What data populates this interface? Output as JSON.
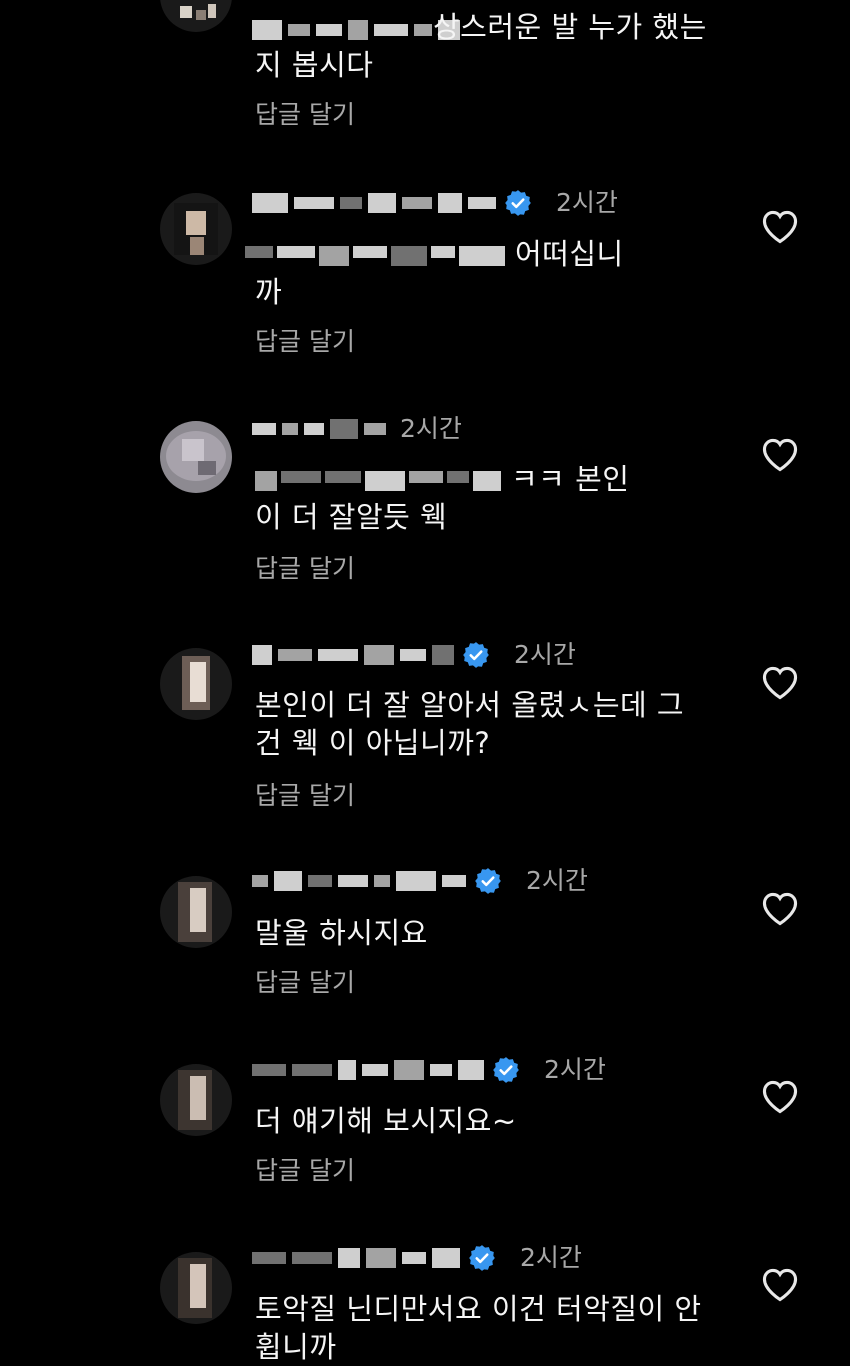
{
  "colors": {
    "background": "#000000",
    "text": "#f5f5f5",
    "muted": "#a8a8a8",
    "verified": "#3897f0"
  },
  "icons": {
    "like": "heart-outline-icon",
    "verified": "verified-badge-icon"
  },
  "comments": [
    {
      "text_line1": "상스러운 발 누가 했는",
      "text_line2": "지 봅시다",
      "reply": "답글 달기"
    },
    {
      "time": "2시간",
      "text_line1": "어떠십니",
      "text_line2": "까",
      "reply": "답글 달기"
    },
    {
      "time": "2시간",
      "text_line1": "ㅋㅋ 본인",
      "text_line2": "이 더 잘알듯 웩",
      "reply": "답글 달기"
    },
    {
      "time": "2시간",
      "text_line1": "본인이 더 잘 알아서 올렸ㅅ는데 그",
      "text_line2": "건 웩 이 아닙니까?",
      "reply": "답글 달기"
    },
    {
      "time": "2시간",
      "text_line1": "말울 하시지요",
      "reply": "답글 달기"
    },
    {
      "time": "2시간",
      "text_line1": "더 얘기해 보시지요~",
      "reply": "답글 달기"
    },
    {
      "time": "2시간",
      "text_line1": "토악질 닌디만서요 이건 터악질이 안",
      "text_line2": "휩니까"
    }
  ]
}
